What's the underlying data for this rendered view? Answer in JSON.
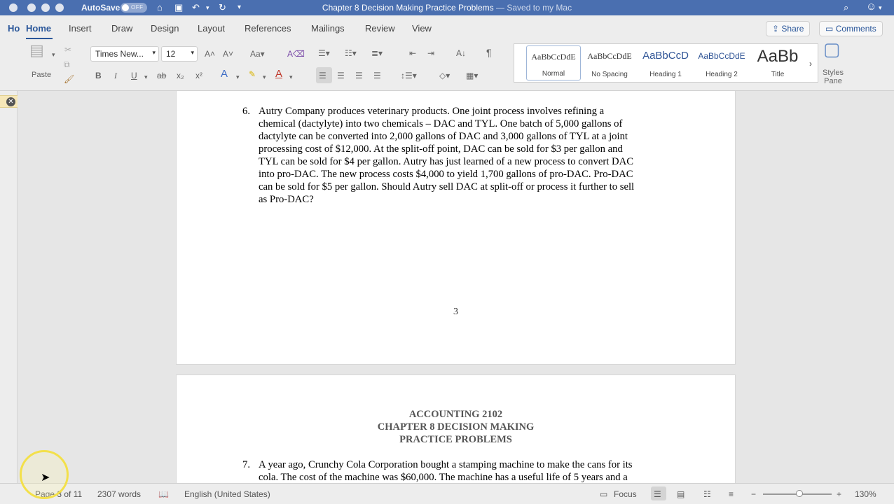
{
  "titlebar": {
    "autosave_label": "AutoSave",
    "autosave_state": "OFF",
    "doc_title": "Chapter 8 Decision Making Practice Problems",
    "saved_status": "— Saved to my Mac"
  },
  "tabs": {
    "items": [
      "Home",
      "Insert",
      "Draw",
      "Design",
      "Layout",
      "References",
      "Mailings",
      "Review",
      "View"
    ],
    "share_label": "Share",
    "comments_label": "Comments"
  },
  "ribbon": {
    "paste_label": "Paste",
    "font_name": "Times New...",
    "font_size": "12",
    "styles": [
      {
        "preview": "AaBbCcDdE",
        "name": "Normal"
      },
      {
        "preview": "AaBbCcDdE",
        "name": "No Spacing"
      },
      {
        "preview": "AaBbCcD",
        "name": "Heading 1"
      },
      {
        "preview": "AaBbCcDdE",
        "name": "Heading 2"
      },
      {
        "preview": "AaBb",
        "name": "Title"
      }
    ],
    "styles_pane_label": "Styles Pane"
  },
  "document": {
    "problem6": {
      "number": "6.",
      "lines": [
        "Autry Company produces veterinary products.  One joint process involves refining a",
        "chemical (dactylyte) into two chemicals – DAC and TYL.  One batch of 5,000 gallons of",
        "dactylyte can be converted into 2,000 gallons of DAC and 3,000 gallons of TYL at a joint",
        "processing cost of $12,000.  At the split-off point, DAC can be sold for $3 per gallon and",
        "TYL can be sold for $4 per gallon.  Autry has just learned of a new process to convert DAC",
        "into pro-DAC.  The new process costs $4,000 to yield 1,700 gallons of pro-DAC.  Pro-DAC",
        "can be sold for $5 per gallon.  Should Autry sell DAC at split-off or process it further to sell",
        "as Pro-DAC?"
      ]
    },
    "page_number": "3",
    "heading": [
      "ACCOUNTING 2102",
      "CHAPTER 8 DECISION MAKING",
      "PRACTICE PROBLEMS"
    ],
    "problem7": {
      "number": "7.",
      "lines": [
        "A year ago, Crunchy Cola Corporation bought a stamping machine to make the cans for its",
        "cola.  The cost of the machine was $60,000.  The machine has a useful life of 5 years and a"
      ]
    }
  },
  "statusbar": {
    "page": "Page 3 of 11",
    "words": "2307 words",
    "language": "English (United States)",
    "focus_label": "Focus",
    "zoom": "130%"
  }
}
